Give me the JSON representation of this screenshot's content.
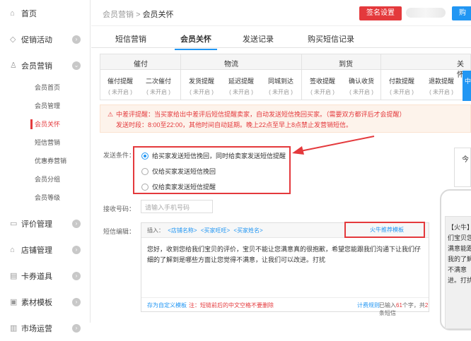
{
  "sidebar": {
    "items": [
      {
        "label": "首页",
        "icon": "home-icon"
      },
      {
        "label": "促销活动",
        "icon": "tag-icon"
      },
      {
        "label": "会员营销",
        "icon": "user-icon"
      },
      {
        "label": "评价管理",
        "icon": "comment-icon"
      },
      {
        "label": "店铺管理",
        "icon": "shop-icon"
      },
      {
        "label": "卡券道具",
        "icon": "card-icon"
      },
      {
        "label": "素材模板",
        "icon": "image-icon"
      },
      {
        "label": "市场运营",
        "icon": "chart-icon"
      }
    ],
    "member_sub": [
      "会员首页",
      "会员管理",
      "会员关怀",
      "短信营销",
      "优惠券营销",
      "会员分组",
      "会员等级"
    ]
  },
  "header": {
    "breadcrumb_parent": "会员营销",
    "breadcrumb_sep": ">",
    "breadcrumb_current": "会员关怀",
    "sign_button": "签名设置",
    "buy_button": "购"
  },
  "tabs": [
    "短信营销",
    "会员关怀",
    "发送记录",
    "购买短信记录"
  ],
  "categories": {
    "headers": [
      "催付",
      "物流",
      "到货",
      "关怀"
    ],
    "items": [
      {
        "name": "催付提醒",
        "status": "( 未开启 )"
      },
      {
        "name": "二次催付",
        "status": "( 未开启 )"
      },
      {
        "name": "发货提醒",
        "status": "( 未开启 )"
      },
      {
        "name": "延迟提醒",
        "status": "( 未开启 )"
      },
      {
        "name": "同城到达",
        "status": "( 未开启 )"
      },
      {
        "name": "签收提醒",
        "status": "( 未开启 )"
      },
      {
        "name": "确认收货",
        "status": "( 未开启 )"
      },
      {
        "name": "付款提醒",
        "status": "( 未开启 )"
      },
      {
        "name": "退款提醒",
        "status": "( 未开启 )"
      }
    ],
    "active_partial": "中"
  },
  "warning": {
    "line1": "中差评提醒：当买家给出中差评后短信提醒卖家，自动发送短信挽回买家。（需要双方都评后才会提醒）",
    "line2": "发送时段：8:00至22:00，其他时间自动延期。晚上22点至早上8点禁止发营销短信。"
  },
  "send_condition": {
    "label": "发送条件：",
    "options": [
      "给买家发送短信挽回，同时给卖家发送短信提醒",
      "仅给买家发送短信挽回",
      "仅给卖家发送短信提醒"
    ],
    "selected": 0
  },
  "receiver": {
    "label": "接收号码：",
    "placeholder": "请输入手机号码"
  },
  "editor": {
    "label": "短信编辑：",
    "insert_label": "插入：",
    "tokens": [
      "<店铺名称>",
      "<买家旺旺>",
      "<买家姓名>"
    ],
    "recommend": "火牛推荐模板",
    "content": "您好，收到您给我们宝贝的评价，宝贝不能让您满意真的很抱歉，希望您能跟我们沟通下让我们仔细的了解到是哪些方面让您觉得不满意，让我们可以改进。打扰",
    "save_template": "存为自定义模板",
    "note": "注：短链前后的中文空格不要删除",
    "billing_rule": "计费规则",
    "count_prefix": "已输入",
    "count_chars": "61",
    "count_mid": "个字，共",
    "count_sms": "2",
    "count_suffix": "条短信"
  },
  "side_box": "今",
  "phone_preview": "【火牛】们宝贝您满意能跟我的了解不满意进。打扰"
}
